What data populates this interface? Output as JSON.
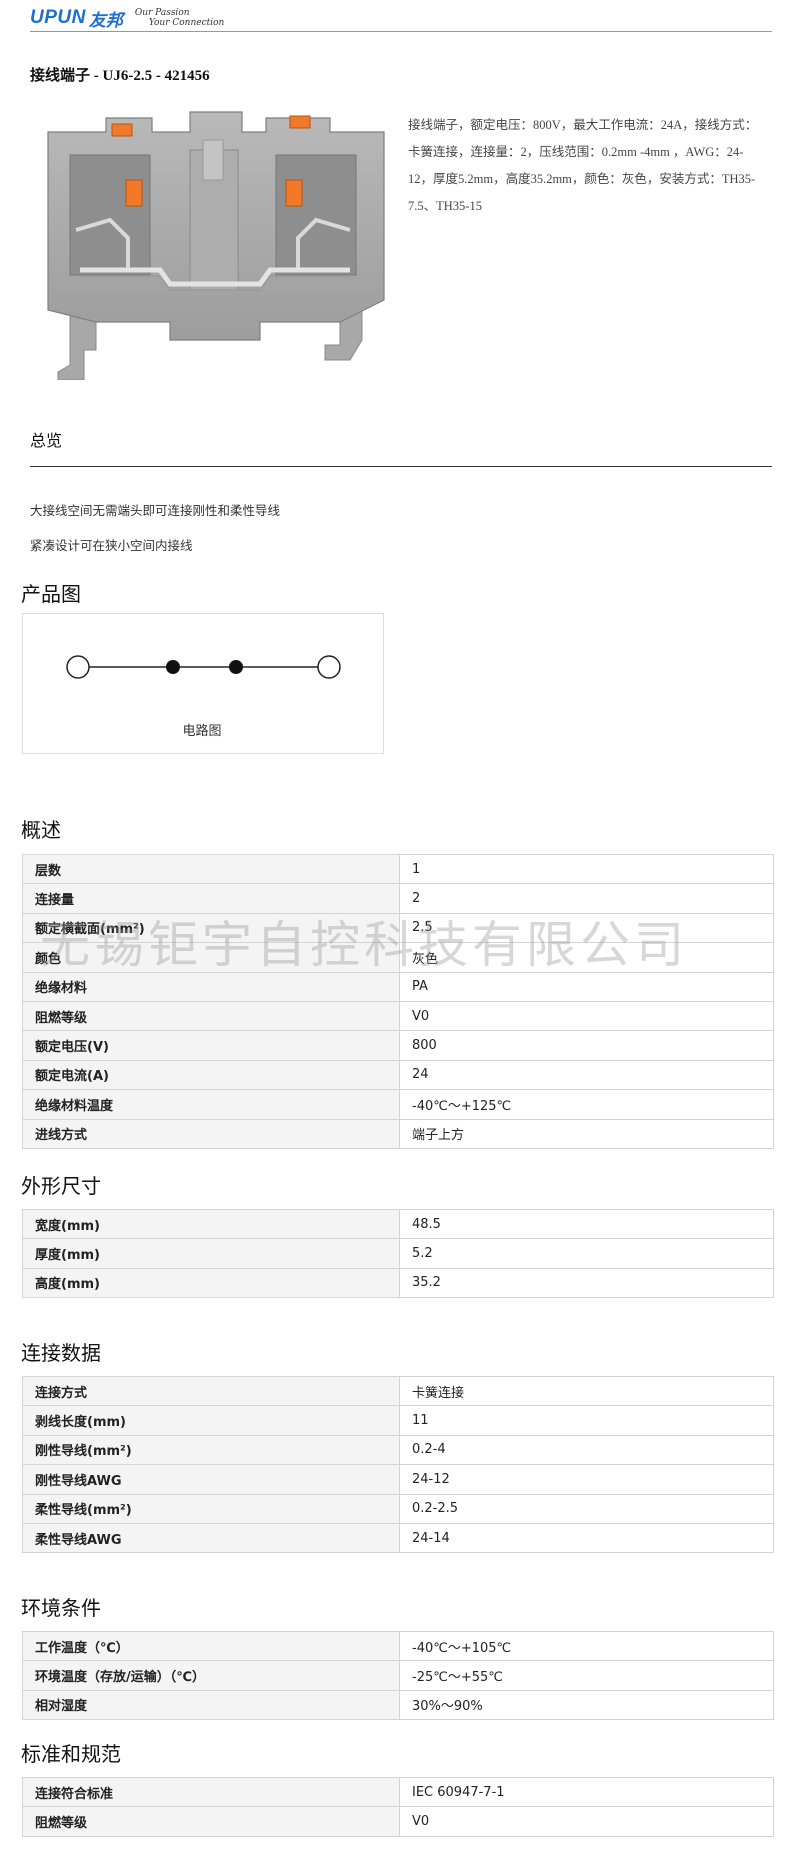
{
  "header": {
    "logo_latin": "UPUN",
    "logo_cn": "友邦",
    "slogan_line1": "Our Passion",
    "slogan_line2": "Your Connection",
    "accent_color": "#1c6fd0"
  },
  "product": {
    "title": "接线端子 - UJ6-2.5 - 421456",
    "description": "接线端子，额定电压：800V，最大工作电流：24A，接线方式：卡簧连接，连接量：2，压线范围：0.2mm  -4mm  ，AWG：24-12，厚度5.2mm，高度35.2mm，颜色：灰色，安装方式：TH35-7.5、TH35-15",
    "photo_icon": "terminal-block-image"
  },
  "overview": {
    "title": "总览",
    "features": [
      "大接线空间无需端头即可连接刚性和柔性导线",
      "紧凑设计可在狭小空间内接线"
    ]
  },
  "diagram": {
    "heading": "产品图",
    "caption": "电路图"
  },
  "watermark": "无锡钜宇自控科技有限公司",
  "sections": [
    {
      "heading": "概述",
      "rows": [
        [
          "层数",
          "1"
        ],
        [
          "连接量",
          "2"
        ],
        [
          "额定横截面(mm²)",
          "2.5"
        ],
        [
          "颜色",
          "灰色"
        ],
        [
          "绝缘材料",
          "PA"
        ],
        [
          "阻燃等级",
          "V0"
        ],
        [
          "额定电压(V)",
          "800"
        ],
        [
          "额定电流(A)",
          "24"
        ],
        [
          "绝缘材料温度",
          "-40℃～+125℃"
        ],
        [
          "进线方式",
          "端子上方"
        ]
      ]
    },
    {
      "heading": "外形尺寸",
      "rows": [
        [
          "宽度(mm)",
          "48.5"
        ],
        [
          "厚度(mm)",
          "5.2"
        ],
        [
          "高度(mm)",
          "35.2"
        ]
      ]
    },
    {
      "heading": "连接数据",
      "rows": [
        [
          "连接方式",
          "卡簧连接"
        ],
        [
          "剥线长度(mm)",
          "11"
        ],
        [
          "刚性导线(mm²)",
          "0.2-4"
        ],
        [
          "刚性导线AWG",
          "24-12"
        ],
        [
          "柔性导线(mm²)",
          "0.2-2.5"
        ],
        [
          "柔性导线AWG",
          "24-14"
        ]
      ]
    },
    {
      "heading": "环境条件",
      "rows": [
        [
          "工作温度（℃）",
          "-40℃～+105℃"
        ],
        [
          "环境温度（存放/运输）（℃）",
          "-25℃～+55℃"
        ],
        [
          "相对湿度",
          "30%～90%"
        ]
      ]
    },
    {
      "heading": "标准和规范",
      "rows": [
        [
          "连接符合标准",
          "IEC 60947-7-1"
        ],
        [
          "阻燃等级",
          "V0"
        ]
      ]
    }
  ]
}
